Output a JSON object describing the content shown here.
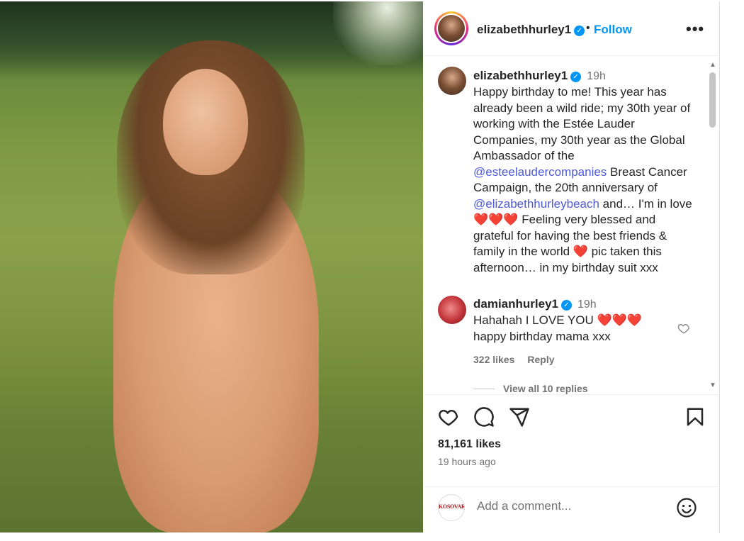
{
  "post": {
    "image_alt": "photo of woman sitting in a grassy meadow"
  },
  "header": {
    "username": "elizabethhurley1",
    "verified_icon": "verified-badge-icon",
    "separator": "•",
    "follow_label": "Follow",
    "more_label": "•••"
  },
  "caption": {
    "username": "elizabethhurley1",
    "time": "19h",
    "text_1": "Happy birthday to me! This year has already been a wild ride; my 30th year of working with the Estée Lauder Companies, my 30th year as the Global Ambassador of the ",
    "mention_1": "@esteelaudercompanies",
    "text_2": " Breast Cancer Campaign, the 20th anniversary of ",
    "mention_2": "@elizabethhurleybeach",
    "text_3": " and… I'm in love ",
    "hearts_1": "❤️❤️❤️",
    "text_4": " Feeling very blessed and grateful for having the best friends & family in the world ",
    "heart_2": "❤️",
    "text_5": " pic taken this afternoon… in my birthday suit xxx"
  },
  "comment": {
    "username": "damianhurley1",
    "time": "19h",
    "text_1": "Hahahah I LOVE YOU ",
    "hearts": "❤️❤️❤️",
    "text_2": " happy birthday mama xxx",
    "likes": "322 likes",
    "reply_label": "Reply",
    "view_replies": "View all 10 replies"
  },
  "actions": {
    "like_icon": "heart-icon",
    "comment_icon": "comment-icon",
    "share_icon": "share-icon",
    "save_icon": "bookmark-icon"
  },
  "stats": {
    "likes": "81,161 likes",
    "posted": "19 hours ago"
  },
  "add_comment": {
    "placeholder": "Add a comment...",
    "avatar_text": "KOSOVARJA"
  },
  "colors": {
    "accent": "#0095f6",
    "mention": "#4f5bd5",
    "text": "#262626",
    "muted": "#737373"
  }
}
